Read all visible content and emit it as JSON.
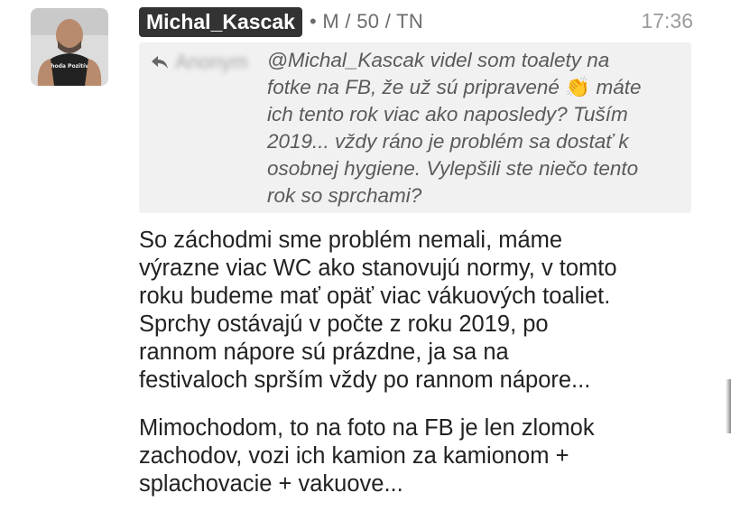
{
  "post": {
    "username": "Michal_Kascak",
    "meta": "• M / 50 / TN",
    "time": "17:36",
    "avatar_text": "Pohoda Pozitívne",
    "quote": {
      "author": "Anonym",
      "icon": "reply-icon",
      "lines": [
        "@Michal_Kascak videl som toalety na",
        "fotke na FB, že už sú pripravené",
        "ich tento rok viac ako naposledy? Tuším",
        "2019... vždy ráno je problém sa dostať k",
        "osobnej hygiene. Vylepšili ste niečo tento",
        "rok so sprchami?"
      ],
      "emoji": "👏",
      "line2_tail": "máte"
    },
    "body_paragraph_1": [
      "So záchodmi sme problém nemali, máme",
      "výrazne viac WC ako stanovujú normy, v tomto",
      "roku budeme mať opäť viac vákuových toaliet.",
      "Sprchy ostávajú v počte z roku 2019, po",
      "rannom nápore sú prázdne, ja sa na",
      "festivaloch sprším vždy po rannom nápore..."
    ],
    "body_paragraph_2": [
      "Mimochodom, to na foto na FB je len zlomok",
      "zachodov, vozi ich kamion za kamionom +",
      "splachovacie + vakuove..."
    ]
  }
}
